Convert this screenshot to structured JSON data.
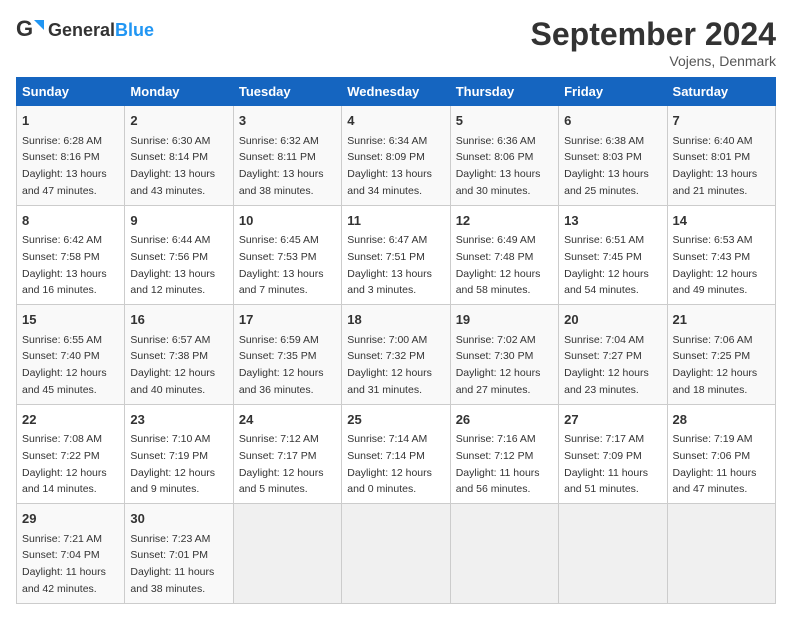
{
  "header": {
    "logo_general": "General",
    "logo_blue": "Blue",
    "title": "September 2024",
    "subtitle": "Vojens, Denmark"
  },
  "weekdays": [
    "Sunday",
    "Monday",
    "Tuesday",
    "Wednesday",
    "Thursday",
    "Friday",
    "Saturday"
  ],
  "weeks": [
    [
      {
        "day": "1",
        "sunrise": "6:28 AM",
        "sunset": "8:16 PM",
        "daylight": "13 hours and 47 minutes."
      },
      {
        "day": "2",
        "sunrise": "6:30 AM",
        "sunset": "8:14 PM",
        "daylight": "13 hours and 43 minutes."
      },
      {
        "day": "3",
        "sunrise": "6:32 AM",
        "sunset": "8:11 PM",
        "daylight": "13 hours and 38 minutes."
      },
      {
        "day": "4",
        "sunrise": "6:34 AM",
        "sunset": "8:09 PM",
        "daylight": "13 hours and 34 minutes."
      },
      {
        "day": "5",
        "sunrise": "6:36 AM",
        "sunset": "8:06 PM",
        "daylight": "13 hours and 30 minutes."
      },
      {
        "day": "6",
        "sunrise": "6:38 AM",
        "sunset": "8:03 PM",
        "daylight": "13 hours and 25 minutes."
      },
      {
        "day": "7",
        "sunrise": "6:40 AM",
        "sunset": "8:01 PM",
        "daylight": "13 hours and 21 minutes."
      }
    ],
    [
      {
        "day": "8",
        "sunrise": "6:42 AM",
        "sunset": "7:58 PM",
        "daylight": "13 hours and 16 minutes."
      },
      {
        "day": "9",
        "sunrise": "6:44 AM",
        "sunset": "7:56 PM",
        "daylight": "13 hours and 12 minutes."
      },
      {
        "day": "10",
        "sunrise": "6:45 AM",
        "sunset": "7:53 PM",
        "daylight": "13 hours and 7 minutes."
      },
      {
        "day": "11",
        "sunrise": "6:47 AM",
        "sunset": "7:51 PM",
        "daylight": "13 hours and 3 minutes."
      },
      {
        "day": "12",
        "sunrise": "6:49 AM",
        "sunset": "7:48 PM",
        "daylight": "12 hours and 58 minutes."
      },
      {
        "day": "13",
        "sunrise": "6:51 AM",
        "sunset": "7:45 PM",
        "daylight": "12 hours and 54 minutes."
      },
      {
        "day": "14",
        "sunrise": "6:53 AM",
        "sunset": "7:43 PM",
        "daylight": "12 hours and 49 minutes."
      }
    ],
    [
      {
        "day": "15",
        "sunrise": "6:55 AM",
        "sunset": "7:40 PM",
        "daylight": "12 hours and 45 minutes."
      },
      {
        "day": "16",
        "sunrise": "6:57 AM",
        "sunset": "7:38 PM",
        "daylight": "12 hours and 40 minutes."
      },
      {
        "day": "17",
        "sunrise": "6:59 AM",
        "sunset": "7:35 PM",
        "daylight": "12 hours and 36 minutes."
      },
      {
        "day": "18",
        "sunrise": "7:00 AM",
        "sunset": "7:32 PM",
        "daylight": "12 hours and 31 minutes."
      },
      {
        "day": "19",
        "sunrise": "7:02 AM",
        "sunset": "7:30 PM",
        "daylight": "12 hours and 27 minutes."
      },
      {
        "day": "20",
        "sunrise": "7:04 AM",
        "sunset": "7:27 PM",
        "daylight": "12 hours and 23 minutes."
      },
      {
        "day": "21",
        "sunrise": "7:06 AM",
        "sunset": "7:25 PM",
        "daylight": "12 hours and 18 minutes."
      }
    ],
    [
      {
        "day": "22",
        "sunrise": "7:08 AM",
        "sunset": "7:22 PM",
        "daylight": "12 hours and 14 minutes."
      },
      {
        "day": "23",
        "sunrise": "7:10 AM",
        "sunset": "7:19 PM",
        "daylight": "12 hours and 9 minutes."
      },
      {
        "day": "24",
        "sunrise": "7:12 AM",
        "sunset": "7:17 PM",
        "daylight": "12 hours and 5 minutes."
      },
      {
        "day": "25",
        "sunrise": "7:14 AM",
        "sunset": "7:14 PM",
        "daylight": "12 hours and 0 minutes."
      },
      {
        "day": "26",
        "sunrise": "7:16 AM",
        "sunset": "7:12 PM",
        "daylight": "11 hours and 56 minutes."
      },
      {
        "day": "27",
        "sunrise": "7:17 AM",
        "sunset": "7:09 PM",
        "daylight": "11 hours and 51 minutes."
      },
      {
        "day": "28",
        "sunrise": "7:19 AM",
        "sunset": "7:06 PM",
        "daylight": "11 hours and 47 minutes."
      }
    ],
    [
      {
        "day": "29",
        "sunrise": "7:21 AM",
        "sunset": "7:04 PM",
        "daylight": "11 hours and 42 minutes."
      },
      {
        "day": "30",
        "sunrise": "7:23 AM",
        "sunset": "7:01 PM",
        "daylight": "11 hours and 38 minutes."
      },
      null,
      null,
      null,
      null,
      null
    ]
  ]
}
